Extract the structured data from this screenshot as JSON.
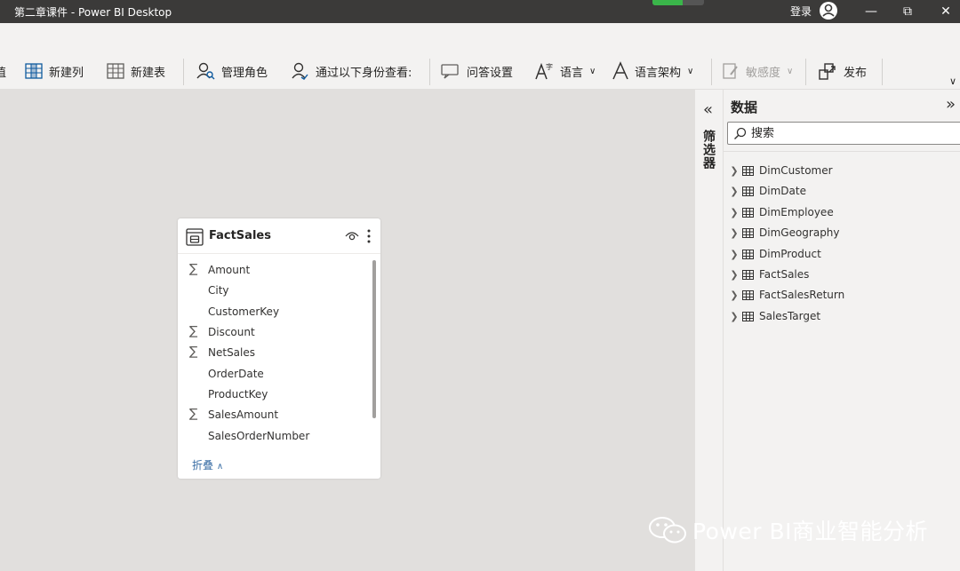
{
  "window": {
    "title": "第二章课件 - Power BI Desktop",
    "login_label": "登录",
    "minimize": "—",
    "restore": "⧉",
    "close": "✕"
  },
  "ribbon": {
    "partial_label": "值",
    "new_column": "新建列",
    "new_table": "新建表",
    "manage_roles": "管理角色",
    "view_as": "通过以下身份查看:",
    "qa_setup": "问答设置",
    "language": "语言",
    "linguistic_schema": "语言架构",
    "sensitivity": "敏感度",
    "publish": "发布"
  },
  "card": {
    "table_name": "FactSales",
    "fields": [
      {
        "name": "Amount",
        "aggregate": true
      },
      {
        "name": "City",
        "aggregate": false
      },
      {
        "name": "CustomerKey",
        "aggregate": false
      },
      {
        "name": "Discount",
        "aggregate": true
      },
      {
        "name": "NetSales",
        "aggregate": true
      },
      {
        "name": "OrderDate",
        "aggregate": false
      },
      {
        "name": "ProductKey",
        "aggregate": false
      },
      {
        "name": "SalesAmount",
        "aggregate": true
      },
      {
        "name": "SalesOrderNumber",
        "aggregate": false
      }
    ],
    "sigma": "∑",
    "collapse_label": "折叠"
  },
  "filters_pane": {
    "label": "筛选器"
  },
  "data_pane": {
    "title": "数据",
    "search_placeholder": "搜索",
    "tables": [
      "DimCustomer",
      "DimDate",
      "DimEmployee",
      "DimGeography",
      "DimProduct",
      "FactSales",
      "FactSalesReturn",
      "SalesTarget"
    ]
  },
  "watermark": {
    "text": "Power BI商业智能分析"
  },
  "colors": {
    "titlebar": "#3b3a39",
    "ribbon": "#f3f2f1",
    "canvas": "#e1dfdd",
    "accent_link": "#3a6ea5"
  }
}
